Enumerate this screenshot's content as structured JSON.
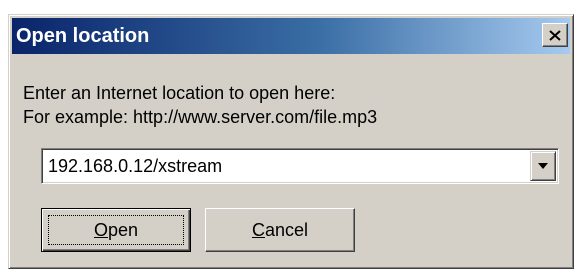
{
  "dialog": {
    "title": "Open location",
    "close_label": "X"
  },
  "prompt": {
    "line1": "Enter an Internet location to open here:",
    "line2": "For example: http://www.server.com/file.mp3"
  },
  "location": {
    "value": "192.168.0.12/xstream"
  },
  "buttons": {
    "open": {
      "mnemonic": "O",
      "rest": "pen"
    },
    "cancel": {
      "mnemonic": "C",
      "rest": "ancel"
    }
  },
  "colors": {
    "titlebar_start": "#0a246a",
    "titlebar_end": "#a6caf0",
    "face": "#d4d0c8"
  }
}
